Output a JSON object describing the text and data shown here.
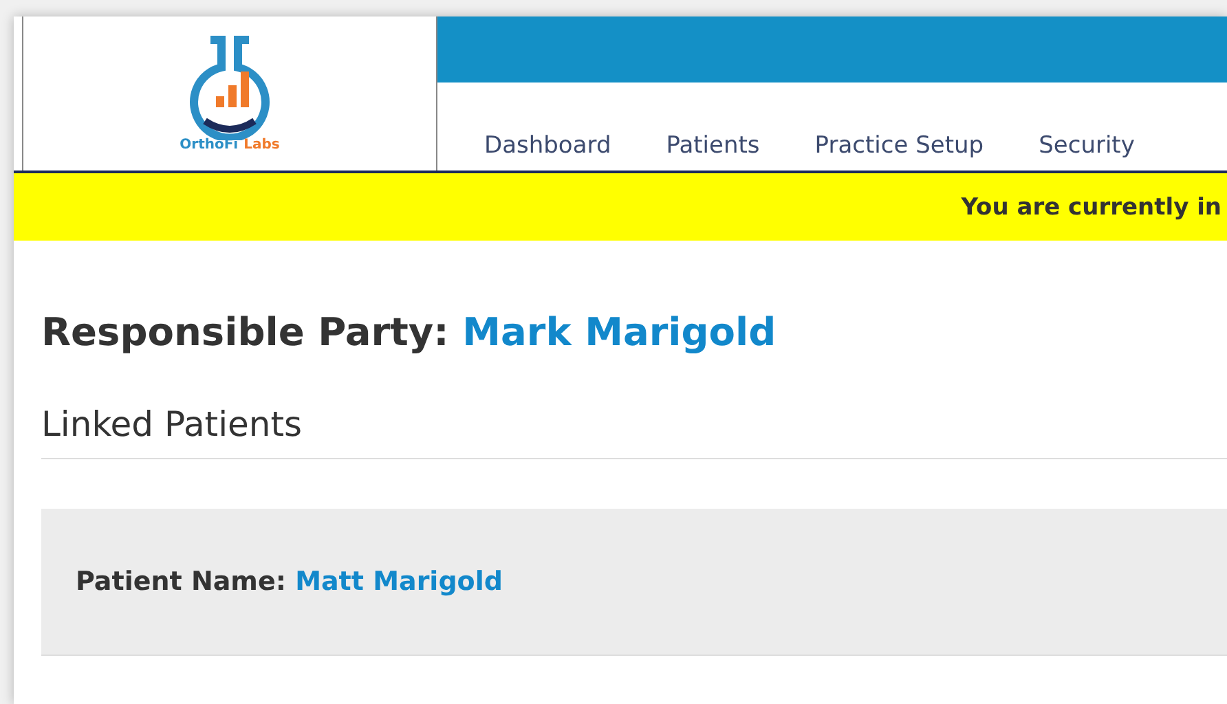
{
  "logo": {
    "brand_first": "OrthoFi",
    "brand_second": "Labs"
  },
  "nav": [
    {
      "label": "Dashboard"
    },
    {
      "label": "Patients"
    },
    {
      "label": "Practice Setup"
    },
    {
      "label": "Security"
    }
  ],
  "banner": "You are currently in",
  "heading": {
    "label": "Responsible Party:",
    "name": "Mark Marigold"
  },
  "section_title": "Linked Patients",
  "patients": [
    {
      "label": "Patient Name:",
      "name": "Matt Marigold"
    }
  ]
}
